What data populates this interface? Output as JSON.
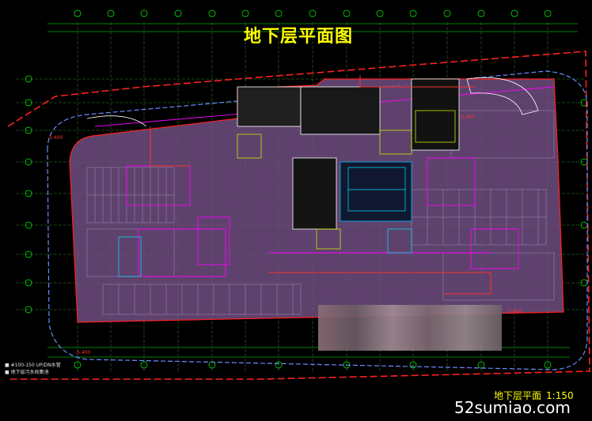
{
  "title": "地下层平面图",
  "caption": {
    "text": "地下层平面",
    "scale": "1:150"
  },
  "watermark": "52sumiao.com",
  "legend_notes": [
    "■ #100-150 UP/DN水管",
    "■ 地下层污水收集池"
  ],
  "colors": {
    "background": "#000000",
    "title": "#ffff00",
    "grid": "#00ff00",
    "parking": "#7a5a8c",
    "wall_red": "#ff2020",
    "magenta": "#ff00ff",
    "cyan": "#00e5ff",
    "redline": "#ff0000",
    "white": "#ffffff"
  }
}
